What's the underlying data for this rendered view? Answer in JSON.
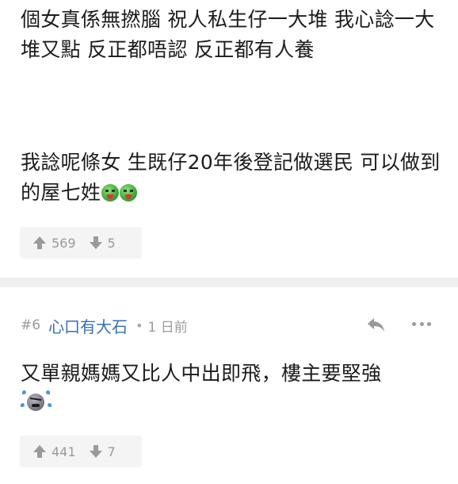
{
  "post_top": {
    "paragraph1": "個女真係無撚腦 祝人私生仔一大堆 我心諗一大堆又點 反正都唔認 反正都有人養",
    "paragraph2": "我諗呢條女 生既仔20年後登記做選民 可以做到的屋七姓",
    "emoji_name": "vomit-face-icon",
    "upvotes": "569",
    "downvotes": "5"
  },
  "reply": {
    "post_number": "#6",
    "username": "心口有大石",
    "separator": "•",
    "time": "1 日前",
    "body": "又單親媽媽又比人中出即飛，樓主要堅強",
    "emoji_name": "angry-face-icon",
    "upvotes": "441",
    "downvotes": "7"
  },
  "colors": {
    "username": "#3a6fb0",
    "meta": "#9a9a9a",
    "divider": "#efefef",
    "vote_bg": "#f4f4f4"
  }
}
